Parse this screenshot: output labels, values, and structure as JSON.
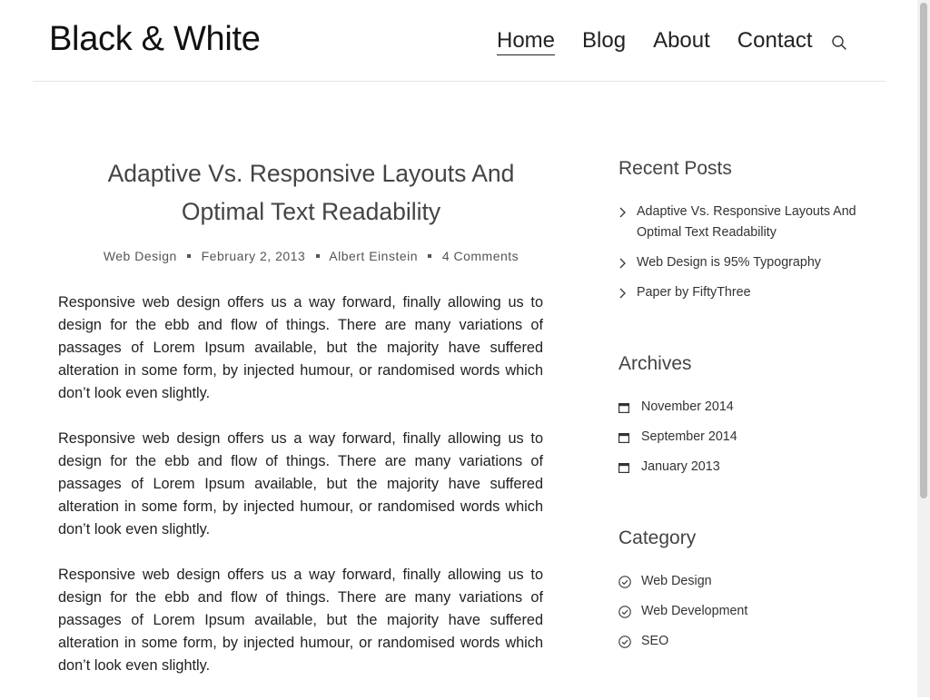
{
  "site": {
    "title": "Black & White"
  },
  "nav": {
    "items": [
      {
        "label": "Home"
      },
      {
        "label": "Blog"
      },
      {
        "label": "About"
      },
      {
        "label": "Contact"
      }
    ],
    "search_icon": "search-icon"
  },
  "post": {
    "title_line1": "Adaptive Vs. Responsive Layouts And",
    "title_line2": "Optimal Text Readability",
    "meta": {
      "category": "Web Design",
      "date": "February 2, 2013",
      "author": "Albert Einstein",
      "comments": "4 Comments"
    },
    "paragraphs": [
      "Responsive web design offers us a way forward, finally allowing us to design for the ebb and flow of things. There are many variations of passages of Lorem Ipsum available, but the majority have suffered alteration in some form, by injected humour, or randomised words which don’t look even slightly.",
      "Responsive web design offers us a way forward, finally allowing us to design for the ebb and flow of things. There are many variations of passages of Lorem Ipsum available, but the majority have suffered alteration in some form, by injected humour, or randomised words which don’t look even slightly.",
      "Responsive web design offers us a way forward, finally allowing us to design for the ebb and flow of things. There are many variations of passages of Lorem Ipsum available, but the majority have suffered alteration in some form, by injected humour, or randomised words which don’t look even slightly."
    ]
  },
  "sidebar": {
    "recent": {
      "title": "Recent Posts",
      "items": [
        {
          "label": "Adaptive Vs. Responsive Layouts And Optimal Text Readability"
        },
        {
          "label": "Web Design is 95% Typography"
        },
        {
          "label": "Paper by FiftyThree"
        }
      ]
    },
    "archives": {
      "title": "Archives",
      "items": [
        {
          "label": "November 2014"
        },
        {
          "label": "September 2014"
        },
        {
          "label": "January 2013"
        }
      ]
    },
    "category": {
      "title": "Category",
      "items": [
        {
          "label": "Web Design"
        },
        {
          "label": "Web Development"
        },
        {
          "label": "SEO"
        }
      ]
    }
  }
}
